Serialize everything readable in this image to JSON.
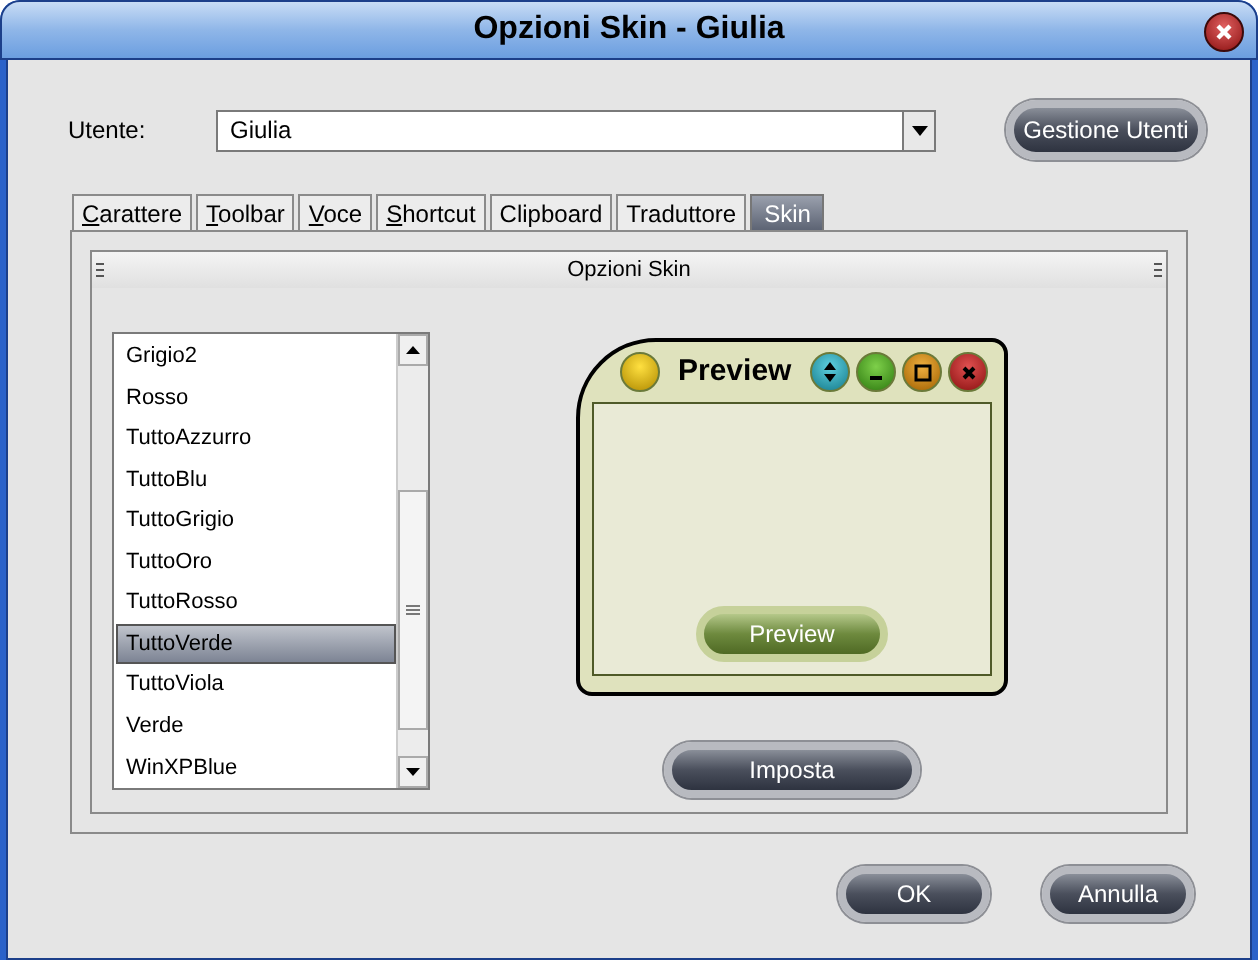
{
  "window": {
    "title": "Opzioni Skin - Giulia"
  },
  "user": {
    "label": "Utente:",
    "value": "Giulia"
  },
  "manage_button": "Gestione Utenti",
  "tabs": [
    {
      "label": "Carattere",
      "mnemonic": true,
      "selected": false
    },
    {
      "label": "Toolbar",
      "mnemonic": true,
      "selected": false
    },
    {
      "label": "Voce",
      "mnemonic": true,
      "selected": false
    },
    {
      "label": "Shortcut",
      "mnemonic": true,
      "selected": false
    },
    {
      "label": "Clipboard",
      "mnemonic": false,
      "selected": false
    },
    {
      "label": "Traduttore",
      "mnemonic": false,
      "selected": false
    },
    {
      "label": "Skin",
      "mnemonic": false,
      "selected": true
    }
  ],
  "panel": {
    "title": "Opzioni Skin"
  },
  "skins": [
    {
      "name": "Grigio2",
      "selected": false
    },
    {
      "name": "Rosso",
      "selected": false
    },
    {
      "name": "TuttoAzzurro",
      "selected": false
    },
    {
      "name": "TuttoBlu",
      "selected": false
    },
    {
      "name": "TuttoGrigio",
      "selected": false
    },
    {
      "name": "TuttoOro",
      "selected": false
    },
    {
      "name": "TuttoRosso",
      "selected": false
    },
    {
      "name": "TuttoVerde",
      "selected": true
    },
    {
      "name": "TuttoViola",
      "selected": false
    },
    {
      "name": "Verde",
      "selected": false
    },
    {
      "name": "WinXPBlue",
      "selected": false
    }
  ],
  "preview": {
    "title": "Preview",
    "button": "Preview"
  },
  "apply_button": "Imposta",
  "buttons": [
    {
      "label": "OK"
    },
    {
      "label": "Annulla"
    }
  ]
}
